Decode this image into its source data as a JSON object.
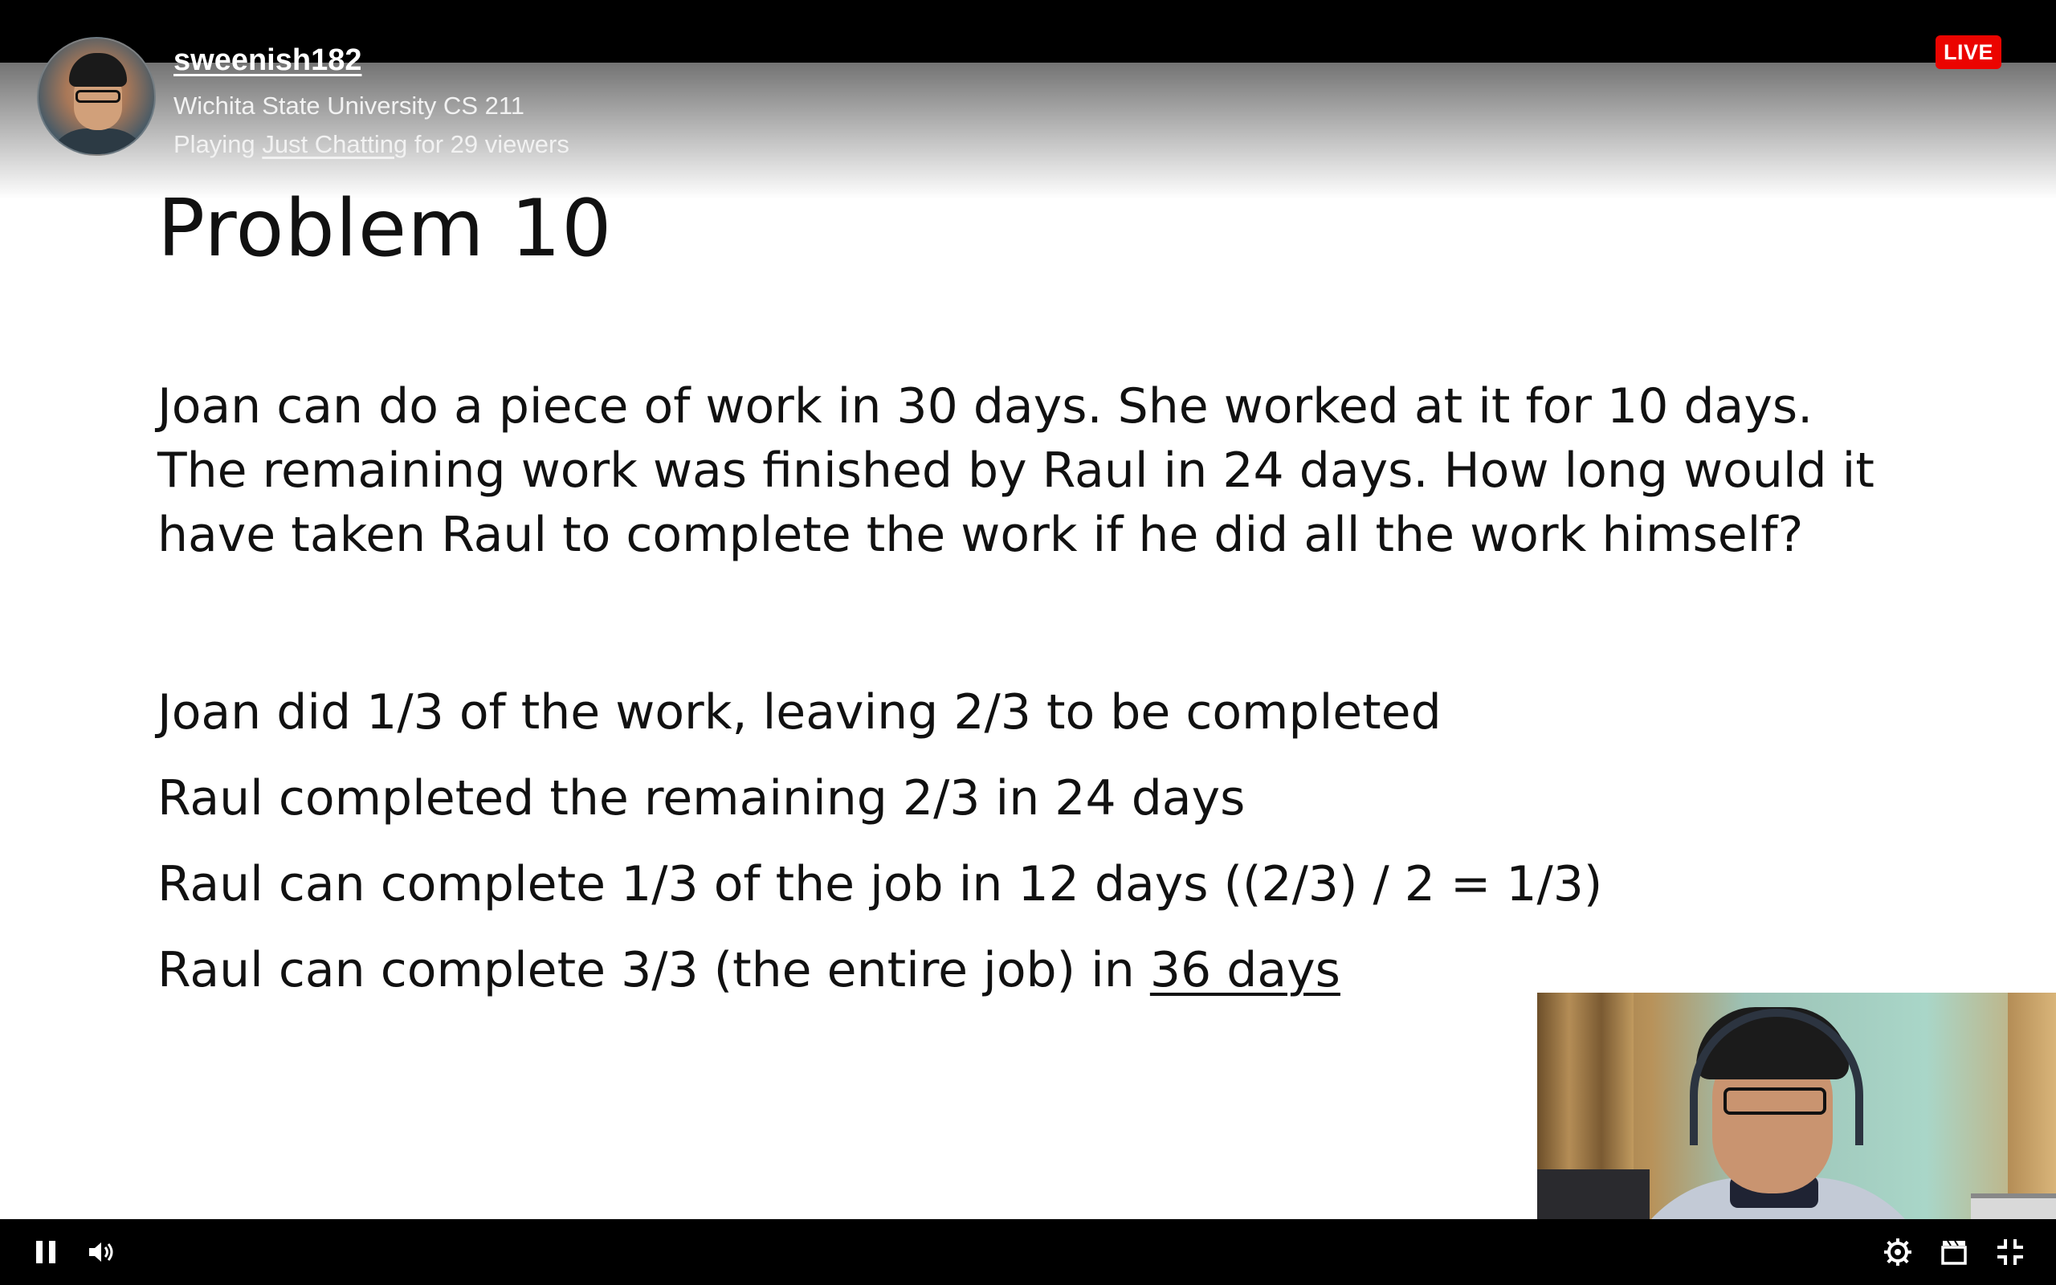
{
  "stream": {
    "streamer_name": "sweenish182",
    "title": "Wichita State University CS 211",
    "meta_prefix": "Playing",
    "game": "Just Chatting",
    "meta_suffix": "for 29 viewers",
    "live_label": "LIVE"
  },
  "slide": {
    "title": "Problem 10",
    "problem_lines": [
      "Joan can do a piece of work in 30 days. She worked at it for 10 days.",
      "The remaining work was finished by Raul in 24 days. How long would it",
      "have taken Raul to complete the work if he did all the work himself?"
    ],
    "steps": [
      "Joan did 1/3 of the work, leaving 2/3 to be completed",
      "Raul completed the remaining 2/3 in 24 days",
      "Raul can complete 1/3 of the job in 12 days ((2/3) / 2 = 1/3)",
      "Raul can complete 3/3 (the entire job) in "
    ],
    "answer": "36 days"
  },
  "controls": {
    "left": [
      "pause-icon",
      "volume-icon"
    ],
    "right": [
      "settings-icon",
      "clip-icon",
      "exit-fullscreen-icon"
    ]
  },
  "colors": {
    "live_badge": "#eb0400",
    "controls_bg": "#000000",
    "slide_bg": "#ffffff"
  }
}
